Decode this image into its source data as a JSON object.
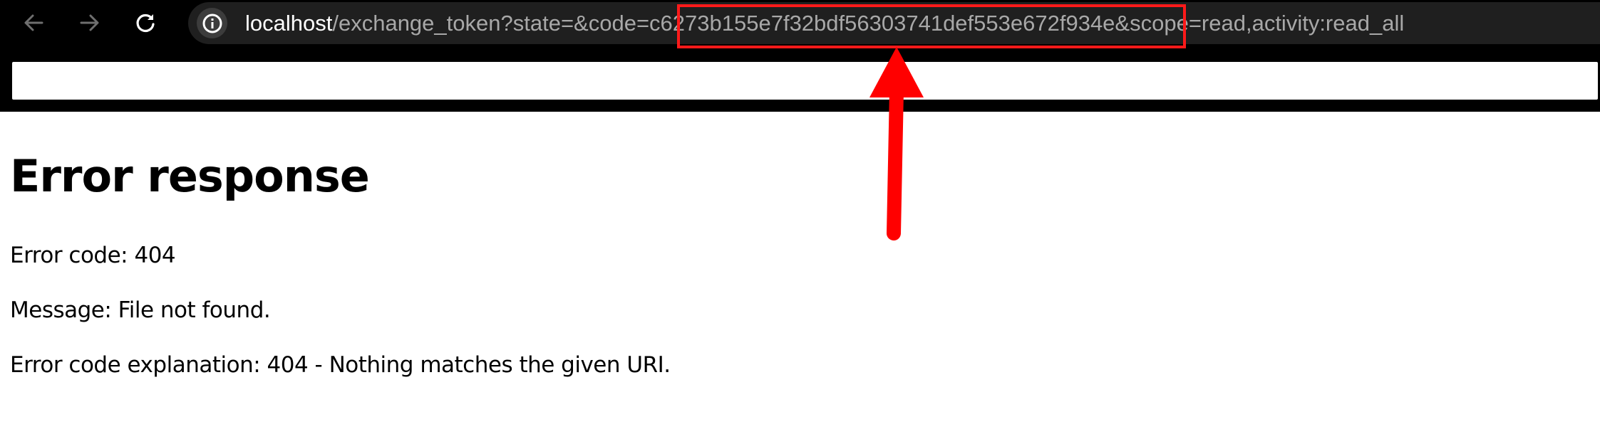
{
  "browser": {
    "url_host": "localhost",
    "url_rest": "/exchange_token?state=&code=c6273b155e7f32bdf56303741def553e672f934e&scope=read,activity:read_all",
    "back_icon": "arrow-left-icon",
    "forward_icon": "arrow-right-icon",
    "reload_icon": "reload-icon",
    "site_info_icon": "info-icon"
  },
  "page": {
    "title": "Error response",
    "error_code_line": "Error code: 404",
    "message_line": "Message: File not found.",
    "explanation_line": "Error code explanation: 404 - Nothing matches the given URI."
  },
  "annotation": {
    "color": "#ff1a1a"
  }
}
